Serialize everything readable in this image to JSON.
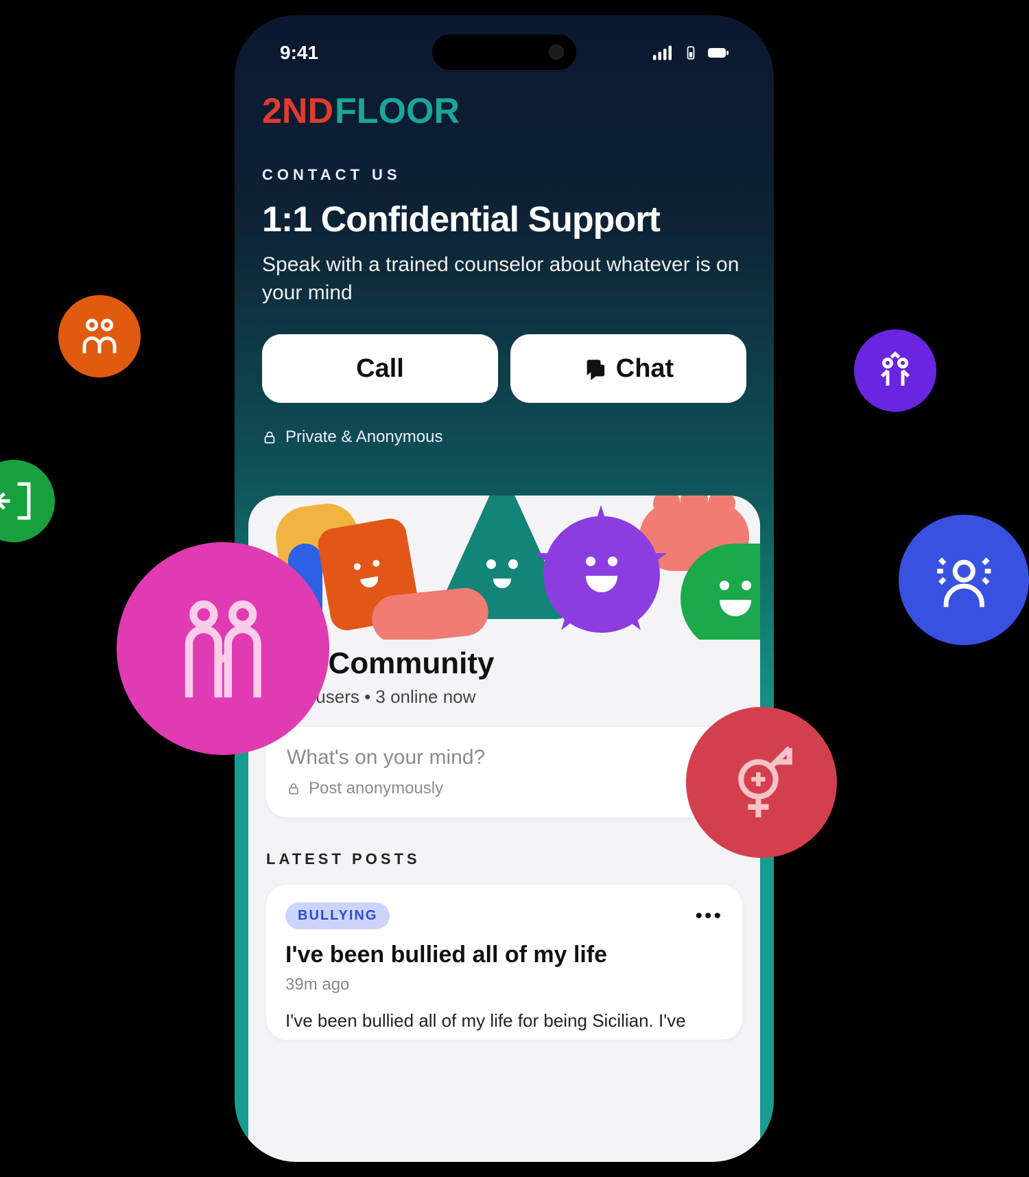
{
  "status": {
    "time": "9:41"
  },
  "logo": {
    "part1": "2ND",
    "part2": "FLOOR"
  },
  "contact": {
    "eyebrow": "CONTACT US",
    "title": "1:1 Confidential Support",
    "subtitle": "Speak with a trained counselor about whatever is on your mind",
    "call_label": "Call",
    "chat_label": "Chat",
    "private_label": "Private & Anonymous"
  },
  "community": {
    "title": "Our Community",
    "stats": "2,876 users • 3 online now",
    "compose_placeholder": "What's on your mind?",
    "compose_sub": "Post anonymously"
  },
  "latest": {
    "label": "LATEST POSTS",
    "post": {
      "tag": "BULLYING",
      "title": "I've been bullied all of my life",
      "time": "39m ago",
      "body": "I've been bullied all of my life for being Sicilian. I've"
    }
  }
}
